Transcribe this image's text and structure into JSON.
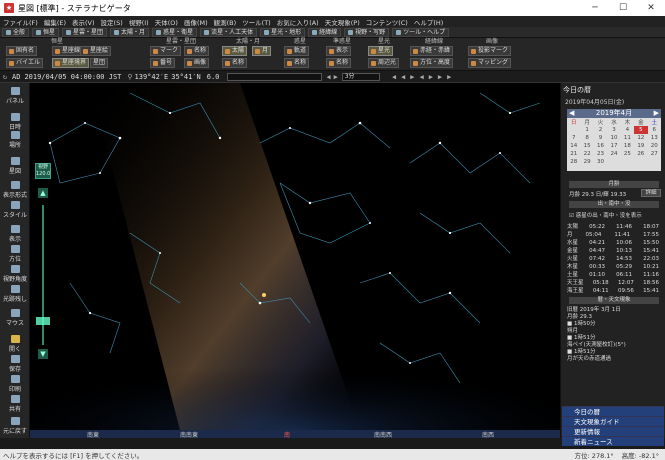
{
  "window": {
    "title": "星図 [標準] - ステラナビゲータ",
    "min": "─",
    "max": "☐",
    "close": "✕"
  },
  "menu": [
    "ファイル(F)",
    "編集(E)",
    "表示(V)",
    "設定(S)",
    "視野(I)",
    "天体(O)",
    "画像(M)",
    "観測(B)",
    "ツール(T)",
    "お気に入り(A)",
    "天文現象(P)",
    "コンテンツ(C)",
    "ヘルプ(H)"
  ],
  "toolbar": [
    "全般",
    "恒星",
    "星雲・星団",
    "太陽・月",
    "惑星・衛星",
    "流星・人工天体",
    "星光・地形",
    "経緯線",
    "視野・写野",
    "ツール・ヘルプ"
  ],
  "ribbon": {
    "groups": {
      "star": "恒星",
      "nebula": "星雲・星団",
      "sunmoon": "太陽・月",
      "planet": "惑星",
      "minor": "準惑星",
      "aurora": "星光",
      "lines": "経緯線",
      "images": "画像"
    },
    "buttons": {
      "star_name": "固有名",
      "bayer": "バイエル",
      "cons_line": "星座線",
      "cons_border": "星座境界",
      "cons_pic": "星座絵",
      "star_label": "星団",
      "nb_mark": "マーク",
      "nb_num": "番号",
      "nb_name": "名称",
      "nb_photo": "画像",
      "sun": "太陽",
      "moon": "月",
      "sm_name": "名称",
      "planet_orbit": "軌道",
      "planet_name": "名称",
      "minor_mark": "表示",
      "minor_name": "名称",
      "aurora": "星光",
      "glow": "周辺光",
      "grid_ad": "赤経・赤緯",
      "grid_alt": "方位・高度",
      "img_mark": "投影マーク",
      "img_map": "マッピング"
    }
  },
  "status": {
    "era": "AD",
    "datetime": "2019/04/05 04:00:00 JST",
    "lon": "139°42′E",
    "lat": "35°41′N",
    "mag": "6.0",
    "search_placeholder": "",
    "step": "3分"
  },
  "left": [
    "パネル",
    "日時",
    "場所",
    "星図",
    "表示形式",
    "スタイル",
    "表示",
    "方位",
    "視野角度",
    "光跡残し",
    "マウス",
    "開く",
    "保存",
    "印刷",
    "共有",
    "元に戻す"
  ],
  "fov": {
    "label": "視野",
    "value": "120.0"
  },
  "right": {
    "title": "今日の暦",
    "date": "2019年04月05日(金)",
    "cal": {
      "month": "2019年4月",
      "days": [
        "日",
        "月",
        "火",
        "水",
        "木",
        "金",
        "土"
      ],
      "rows": [
        [
          "",
          "1",
          "2",
          "3",
          "4",
          "5",
          "6"
        ],
        [
          "7",
          "8",
          "9",
          "10",
          "11",
          "12",
          "13"
        ],
        [
          "14",
          "15",
          "16",
          "17",
          "18",
          "19",
          "20"
        ],
        [
          "21",
          "22",
          "23",
          "24",
          "25",
          "26",
          "27"
        ],
        [
          "28",
          "29",
          "30",
          "",
          "",
          "",
          ""
        ]
      ]
    },
    "moonage_title": "月齢",
    "moonage": "月齢 29.3 日/輝 19.33",
    "moonage_btn": "詳細",
    "rise_title": "出・南中・没",
    "rise_note": "惑星の出・南中・没を表示",
    "planets": [
      [
        "太陽",
        "05:22",
        "11:46",
        "18:07"
      ],
      [
        "月",
        "05:04",
        "11:41",
        "17:55"
      ],
      [
        "水星",
        "04:21",
        "10:06",
        "15:50"
      ],
      [
        "金星",
        "04:47",
        "10:13",
        "15:41"
      ],
      [
        "火星",
        "07:42",
        "14:53",
        "22:03"
      ],
      [
        "木星",
        "00:33",
        "05:29",
        "10:21"
      ],
      [
        "土星",
        "01:10",
        "06:11",
        "11:16"
      ],
      [
        "天王星",
        "05:18",
        "12:07",
        "18:56"
      ],
      [
        "海王星",
        "04:11",
        "09:56",
        "15:41"
      ]
    ],
    "events_title": "暦・天文現象",
    "events": [
      "旧暦 2019年 3月 1日",
      "月齢 29.3",
      "■ 1時50分",
      "朔月",
      "■ 1時51分",
      "海ペイ(天測屋校訂)(5°)",
      "■ 1時51分",
      "月が天の赤道通過"
    ],
    "nav": [
      "今日の暦",
      "天文現象ガイド",
      "更新情報",
      "新着ニュース"
    ]
  },
  "horizon": [
    "南東",
    "南南東",
    "南",
    "南南西",
    "南西"
  ],
  "statusbar": "ヘルプを表示するには [F1] を押してください。",
  "readout": {
    "az": "方位: 278.1°",
    "alt": "高度: -82.1°"
  }
}
